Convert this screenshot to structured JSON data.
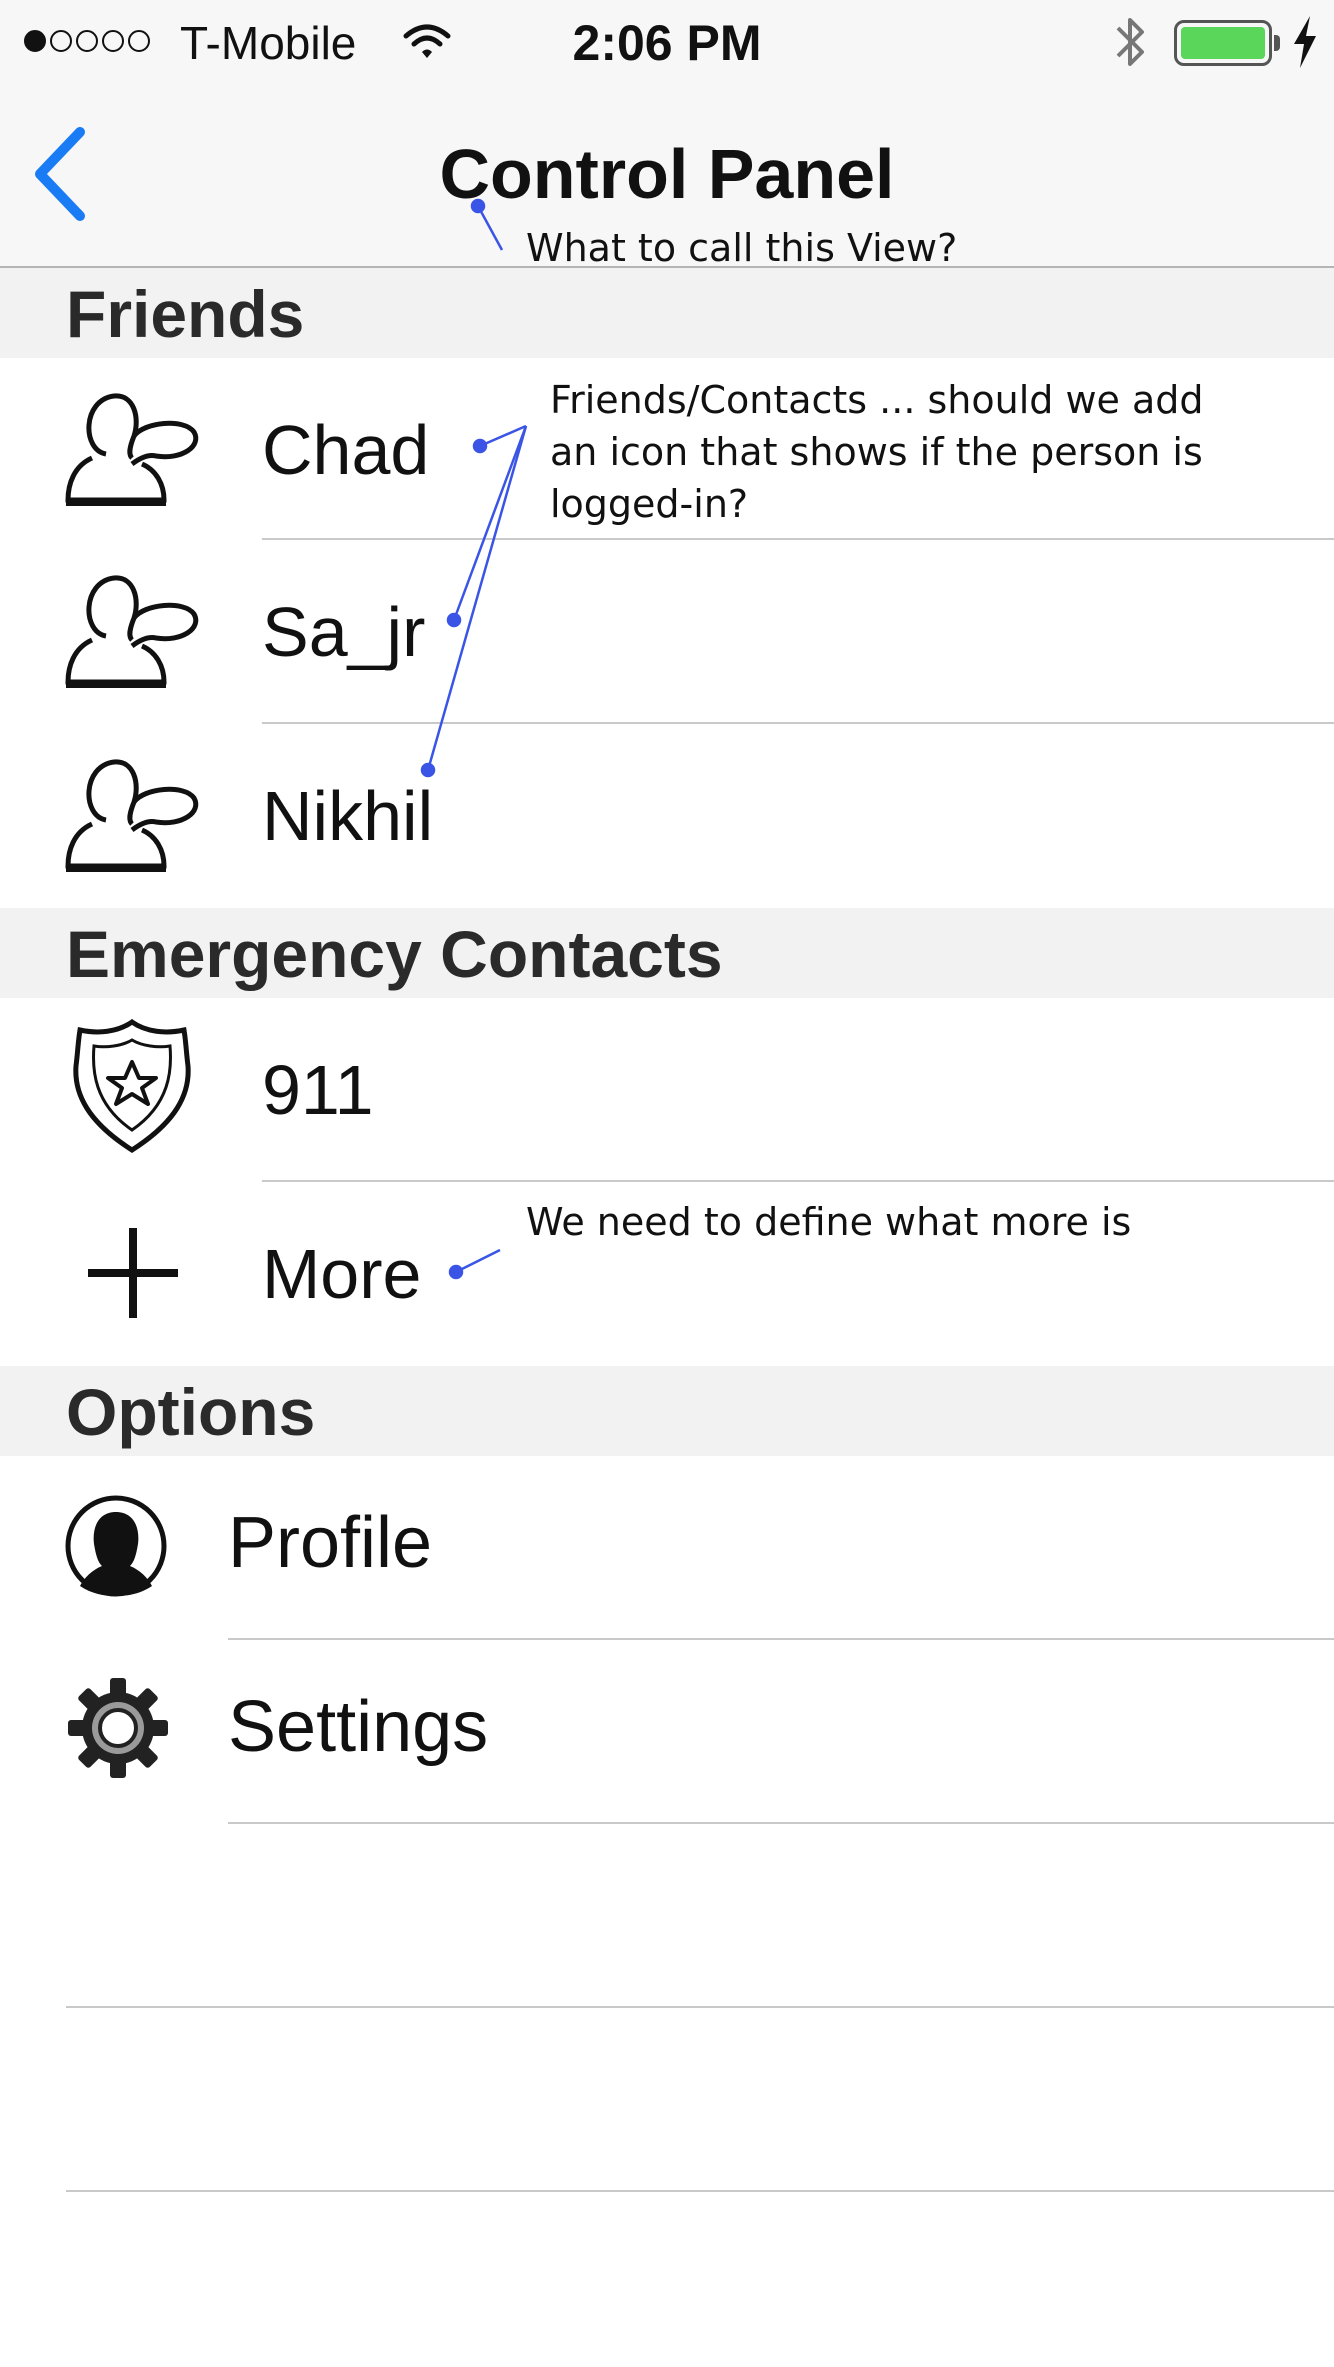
{
  "status_bar": {
    "carrier": "T-Mobile",
    "time": "2:06 PM",
    "signal_bars": [
      true,
      false,
      false,
      false,
      false
    ],
    "battery_color": "#5ad65a",
    "icons": [
      "wifi-icon",
      "bluetooth-icon",
      "battery-icon",
      "charging-icon"
    ]
  },
  "nav": {
    "title": "Control Panel",
    "back_icon": "chevron-left-icon",
    "accent_color": "#1a7cf5"
  },
  "sections": {
    "friends": {
      "title": "Friends",
      "items": [
        {
          "label": "Chad",
          "icon": "user-silhouette-icon"
        },
        {
          "label": "Sa_jr",
          "icon": "user-silhouette-icon"
        },
        {
          "label": "Nikhil",
          "icon": "user-silhouette-icon"
        }
      ]
    },
    "emergency": {
      "title": "Emergency Contacts",
      "items": [
        {
          "label": "911",
          "icon": "police-badge-icon"
        },
        {
          "label": "More",
          "icon": "plus-icon"
        }
      ]
    },
    "options": {
      "title": "Options",
      "items": [
        {
          "label": "Profile",
          "icon": "profile-avatar-icon"
        },
        {
          "label": "Settings",
          "icon": "gear-icon"
        }
      ]
    }
  },
  "annotations": {
    "title_note": "What to call this View?",
    "friends_note": [
      "Friends/Contacts ... should we add",
      "an icon that shows if the person is",
      "logged-in?"
    ],
    "more_note": "We need to define what more is",
    "color": "#3a55e6"
  }
}
